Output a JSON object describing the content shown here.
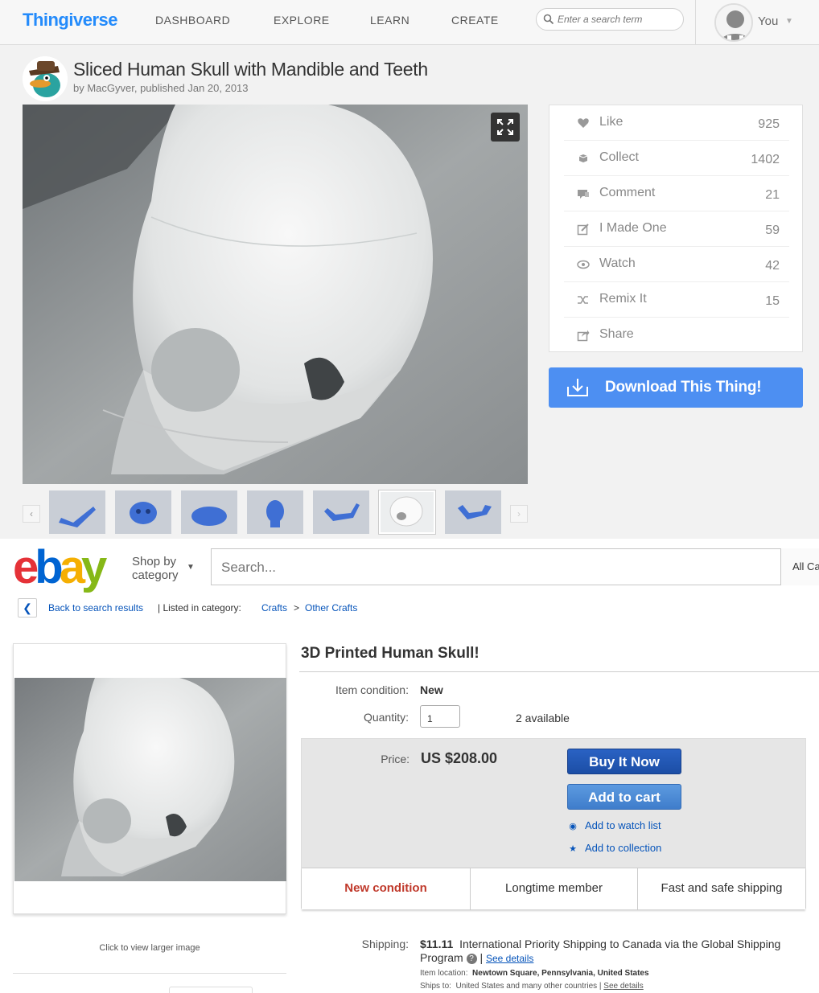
{
  "thingiverse": {
    "logo": "Thingiverse",
    "nav": [
      "DASHBOARD",
      "EXPLORE",
      "LEARN",
      "CREATE"
    ],
    "search_placeholder": "Enter a search term",
    "user_label": "You",
    "title": "Sliced Human Skull with Mandible and Teeth",
    "byline": "by MacGyver, published Jan 20, 2013",
    "actions": [
      {
        "label": "Like",
        "count": "925",
        "icon": "heart-icon"
      },
      {
        "label": "Collect",
        "count": "1402",
        "icon": "collect-icon"
      },
      {
        "label": "Comment",
        "count": "21",
        "icon": "comment-icon"
      },
      {
        "label": "I Made One",
        "count": "59",
        "icon": "made-one-icon"
      },
      {
        "label": "Watch",
        "count": "42",
        "icon": "eye-icon"
      },
      {
        "label": "Remix It",
        "count": "15",
        "icon": "remix-icon"
      },
      {
        "label": "Share",
        "count": "",
        "icon": "share-icon"
      }
    ],
    "download_label": "Download This Thing!",
    "thumb_count": 8
  },
  "ebay": {
    "shop_by": "Shop by",
    "category_word": "category",
    "search_placeholder": "Search...",
    "all_categories": "All Ca",
    "back_label": "Back to search results",
    "listed_in": "| Listed in category:",
    "crumb1": "Crafts",
    "crumb_sep": ">",
    "crumb2": "Other Crafts",
    "title": "3D Printed Human Skull!",
    "condition_label": "Item condition:",
    "condition_value": "New",
    "quantity_label": "Quantity:",
    "quantity_value": "1",
    "available": "2 available",
    "price_label": "Price:",
    "price": "US $208.00",
    "buy_now": "Buy It Now",
    "add_to_cart": "Add to cart",
    "watch_list": "Add to watch list",
    "collection": "Add to collection",
    "features": [
      "New condition",
      "Longtime member",
      "Fast and safe shipping"
    ],
    "click_larger": "Click to view larger image",
    "shipping_label": "Shipping:",
    "shipping_price": "$11.11",
    "shipping_desc": "International Priority Shipping to Canada  via the Global Shipping Program",
    "see_details": "See details",
    "item_location_label": "Item location:",
    "item_location": "Newtown Square, Pennsylvania, United States",
    "ships_to_label": "Ships to:",
    "ships_to": "United States and many other countries",
    "colors": {
      "accent_blue": "#4d8ff2",
      "ebay_link": "#0654ba",
      "new_condition": "#c0392b"
    }
  }
}
